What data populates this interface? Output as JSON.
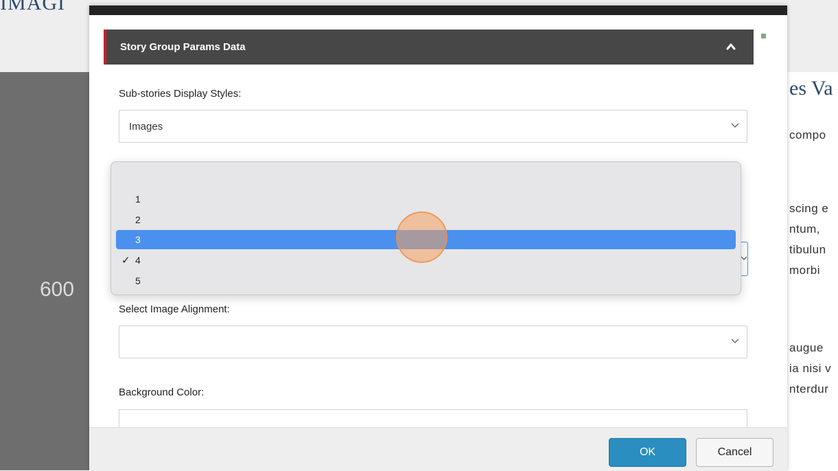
{
  "background": {
    "title_fragment": "IMAGI",
    "left_number": "600",
    "heading_fragment": "es Va",
    "text_lines": [
      "compo",
      "scing e",
      "ntum, ",
      "tibulun",
      "morbi",
      "augue",
      "ia nisi v",
      "nterdur"
    ]
  },
  "modal": {
    "panel_title": "Story Group Params Data",
    "collapse_icon": "chevron-up-icon",
    "fields": {
      "display_styles_label": "Sub-stories Display Styles:",
      "display_styles_value": "Images",
      "image_alignment_label": "Select Image Alignment:",
      "image_alignment_value": "",
      "background_color_label": "Background Color:"
    },
    "buttons": {
      "ok": "OK",
      "cancel": "Cancel"
    }
  },
  "dropdown": {
    "options": [
      {
        "label": "1",
        "checked": false,
        "highlighted": false
      },
      {
        "label": "2",
        "checked": false,
        "highlighted": false
      },
      {
        "label": "3",
        "checked": false,
        "highlighted": true
      },
      {
        "label": "4",
        "checked": true,
        "highlighted": false
      },
      {
        "label": "5",
        "checked": false,
        "highlighted": false
      }
    ],
    "check_glyph": "✓"
  },
  "colors": {
    "accent_red": "#c8202a",
    "highlight_blue": "#4a90ee",
    "ok_blue": "#2a8ec0",
    "panel_header": "#474747"
  }
}
